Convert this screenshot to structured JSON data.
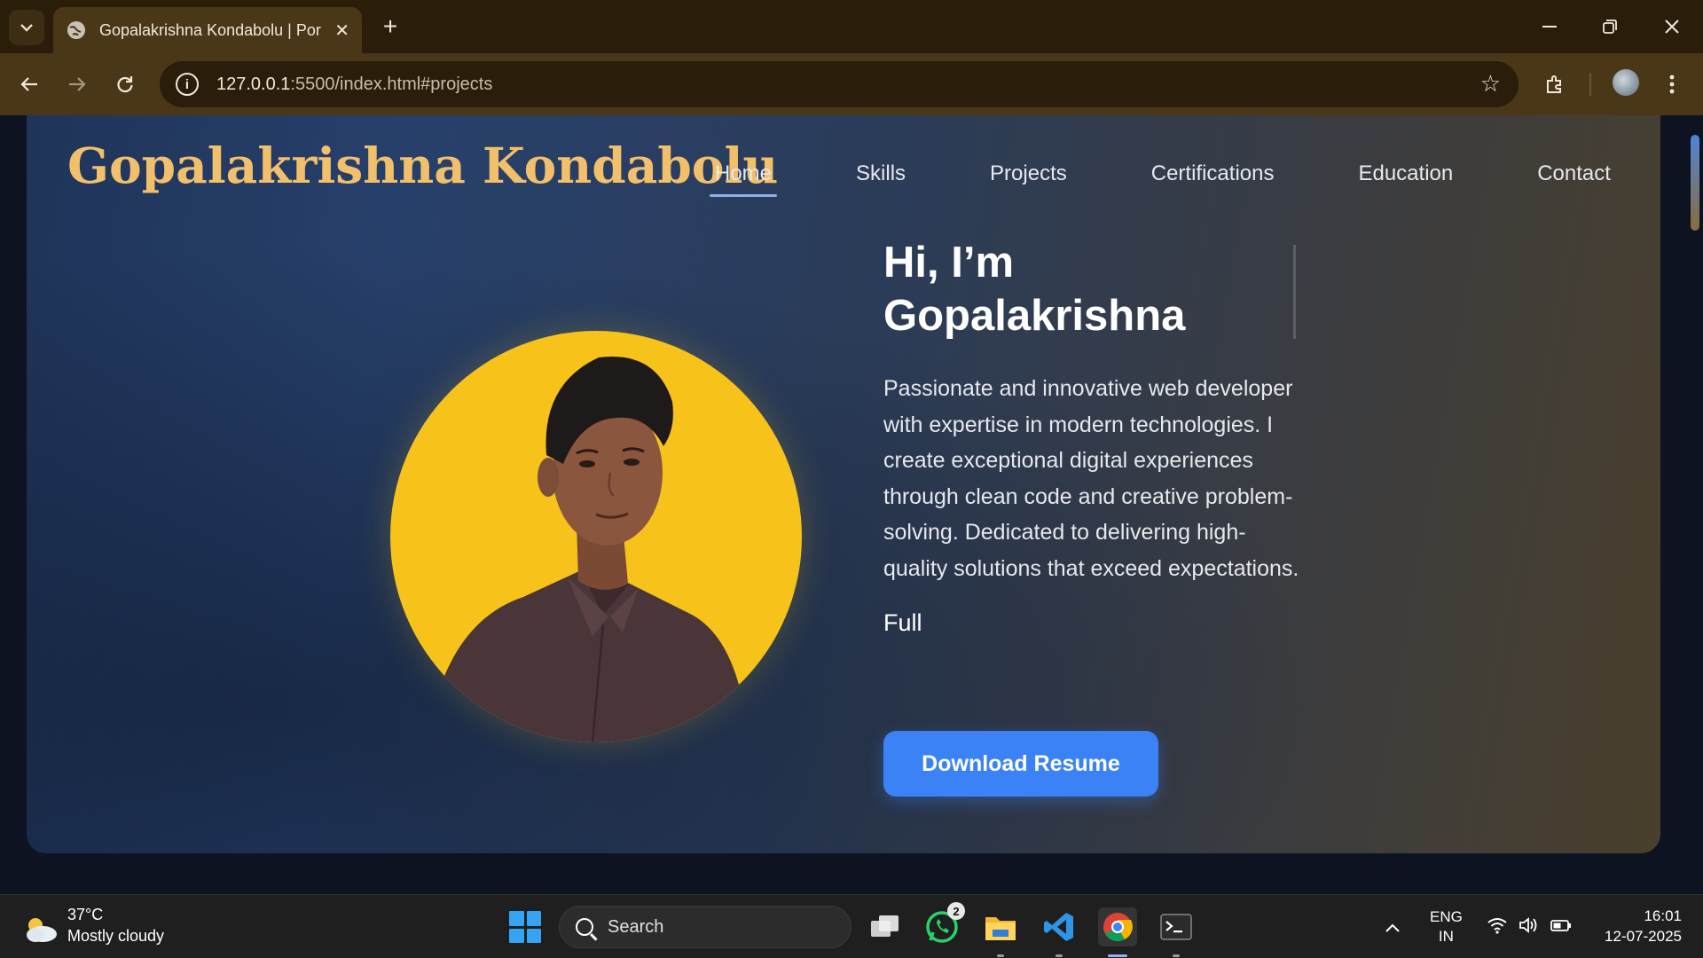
{
  "browser": {
    "tab_title": "Gopalakrishna Kondabolu | Port",
    "url_host": "127.0.0.1",
    "url_rest": ":5500/index.html#projects"
  },
  "site": {
    "brand": "Gopalakrishna Kondabolu",
    "nav": [
      "Home",
      "Skills",
      "Projects",
      "Certifications",
      "Education",
      "Contact"
    ],
    "active_nav": "Home"
  },
  "hero": {
    "greeting_line1": "Hi, I’m",
    "greeting_line2": "Gopalakrishna",
    "bio": "Passionate and innovative web developer with expertise in modern technologies. I create exceptional digital experiences through clean code and creative problem-solving. Dedicated to delivering high-quality solutions that exceed expectations.",
    "typing_text": "Full",
    "resume_button": "Download Resume"
  },
  "taskbar": {
    "weather_temp": "37°C",
    "weather_desc": "Mostly cloudy",
    "search_label": "Search",
    "whatsapp_badge": "2",
    "lang_line1": "ENG",
    "lang_line2": "IN",
    "time": "16:01",
    "date": "12-07-2025"
  }
}
